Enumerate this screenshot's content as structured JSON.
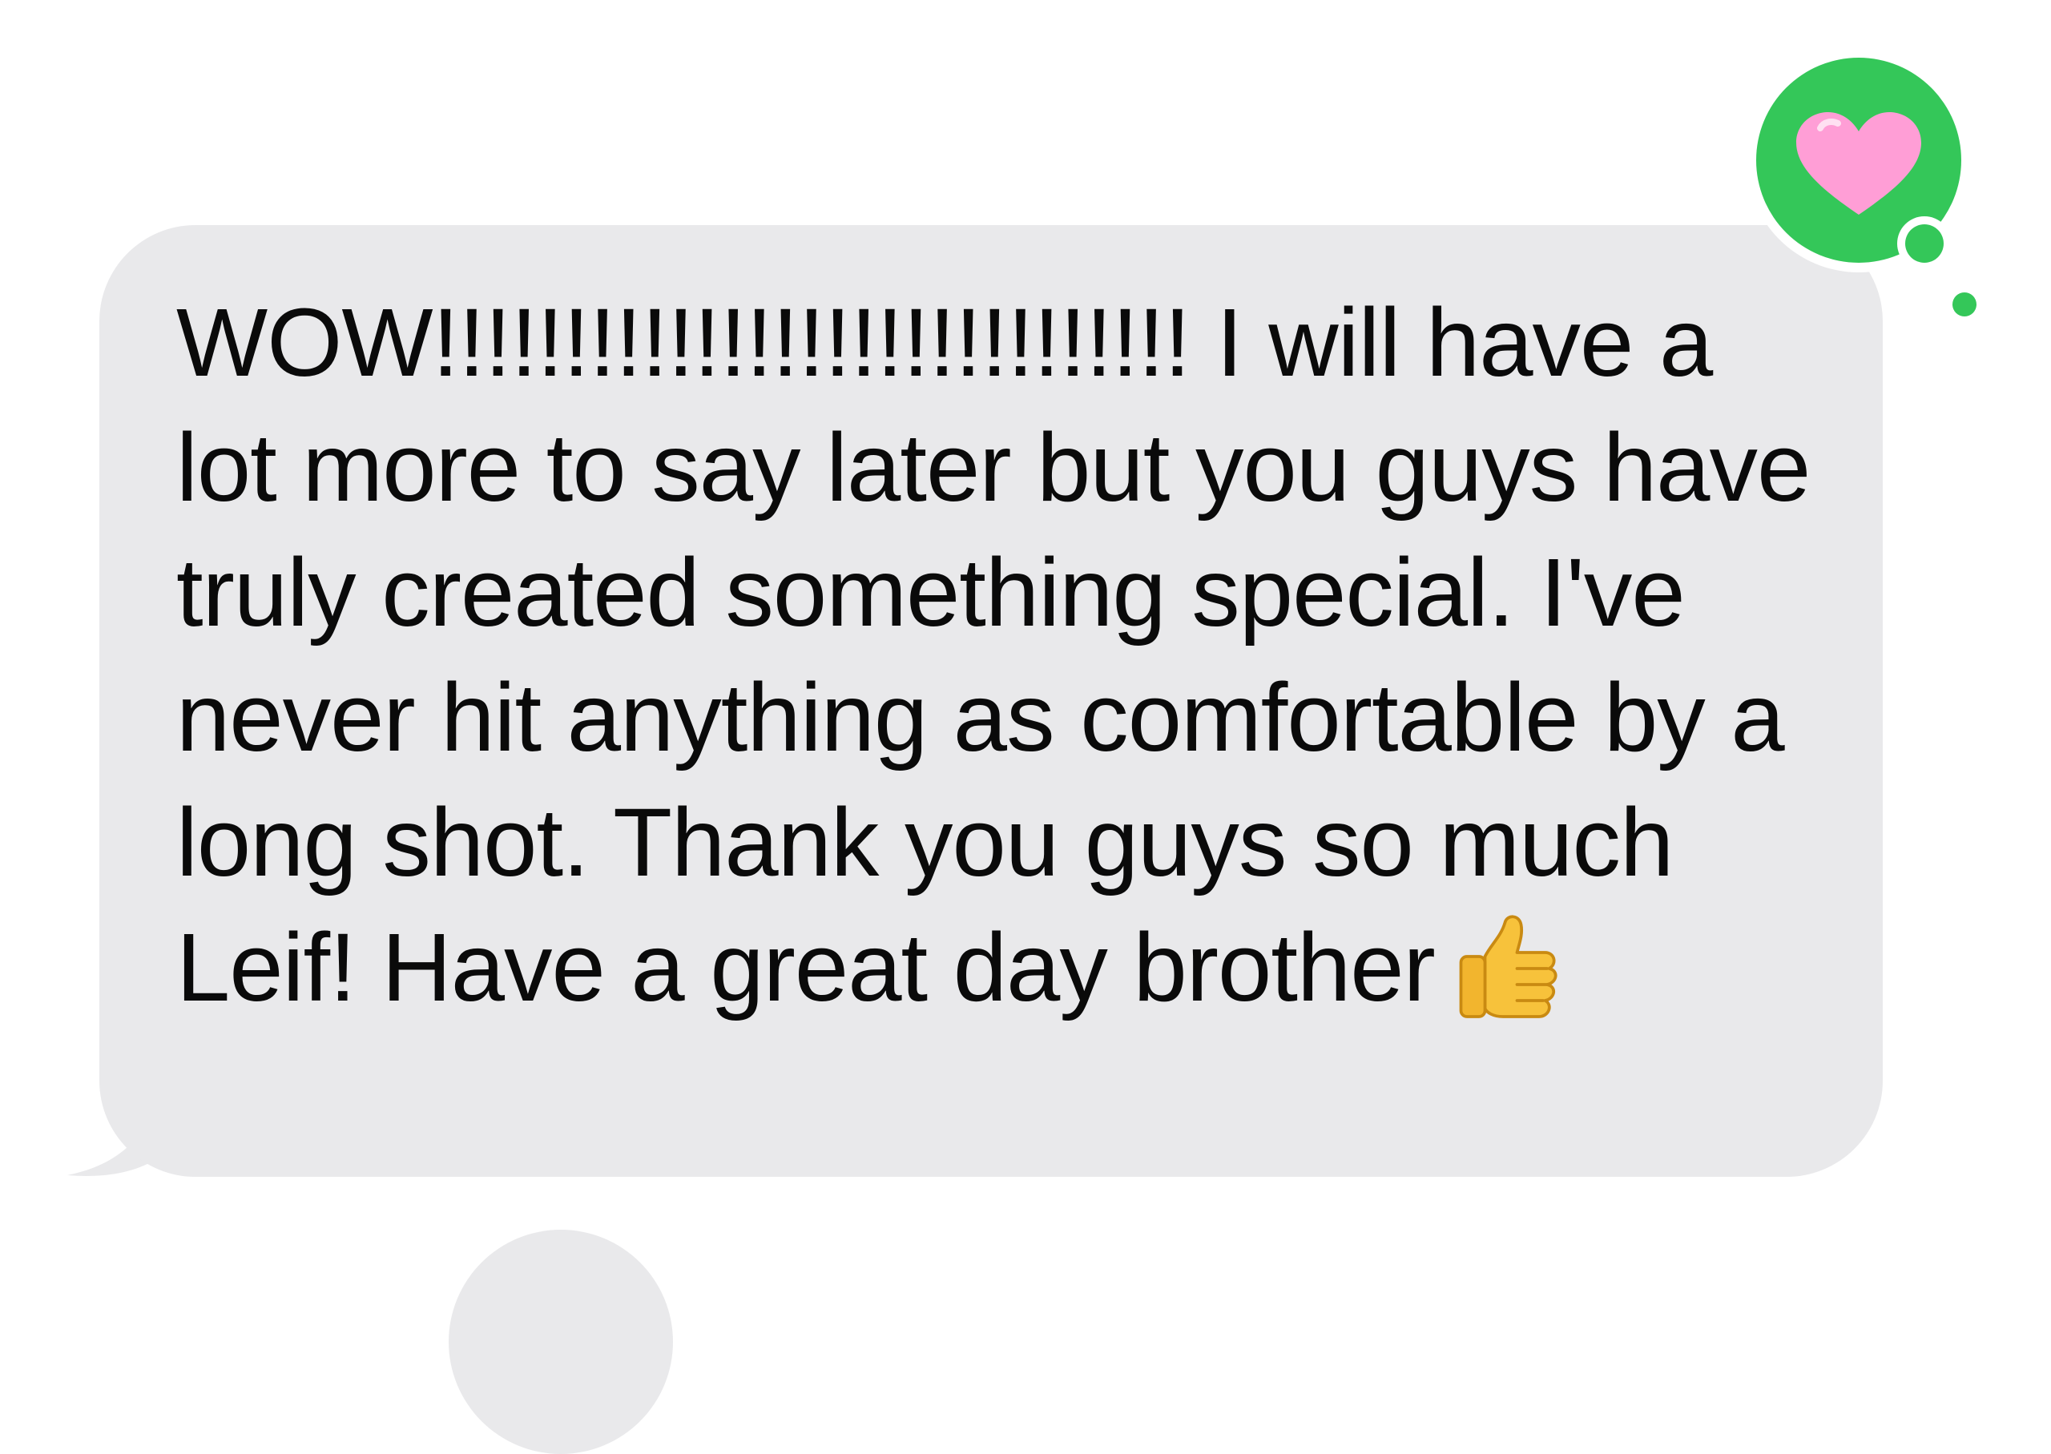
{
  "conversation": {
    "message": {
      "text": "WOW!!!!!!!!!!!!!!!!!!!!!!!!!!!!! I will have a lot more to say later but you guys have truly created something special. I've never hit anything as comfortable by a long shot. Thank you guys so much Leif! Have a great day brother",
      "trailing_emoji": "thumbs-up-icon",
      "reaction": "heart-icon"
    }
  },
  "colors": {
    "bubble": "#e9e9eb",
    "text": "#0a0a0a",
    "tapback": "#34c759",
    "heart": "#ff9ed6",
    "thumb": "#f7c23b"
  }
}
